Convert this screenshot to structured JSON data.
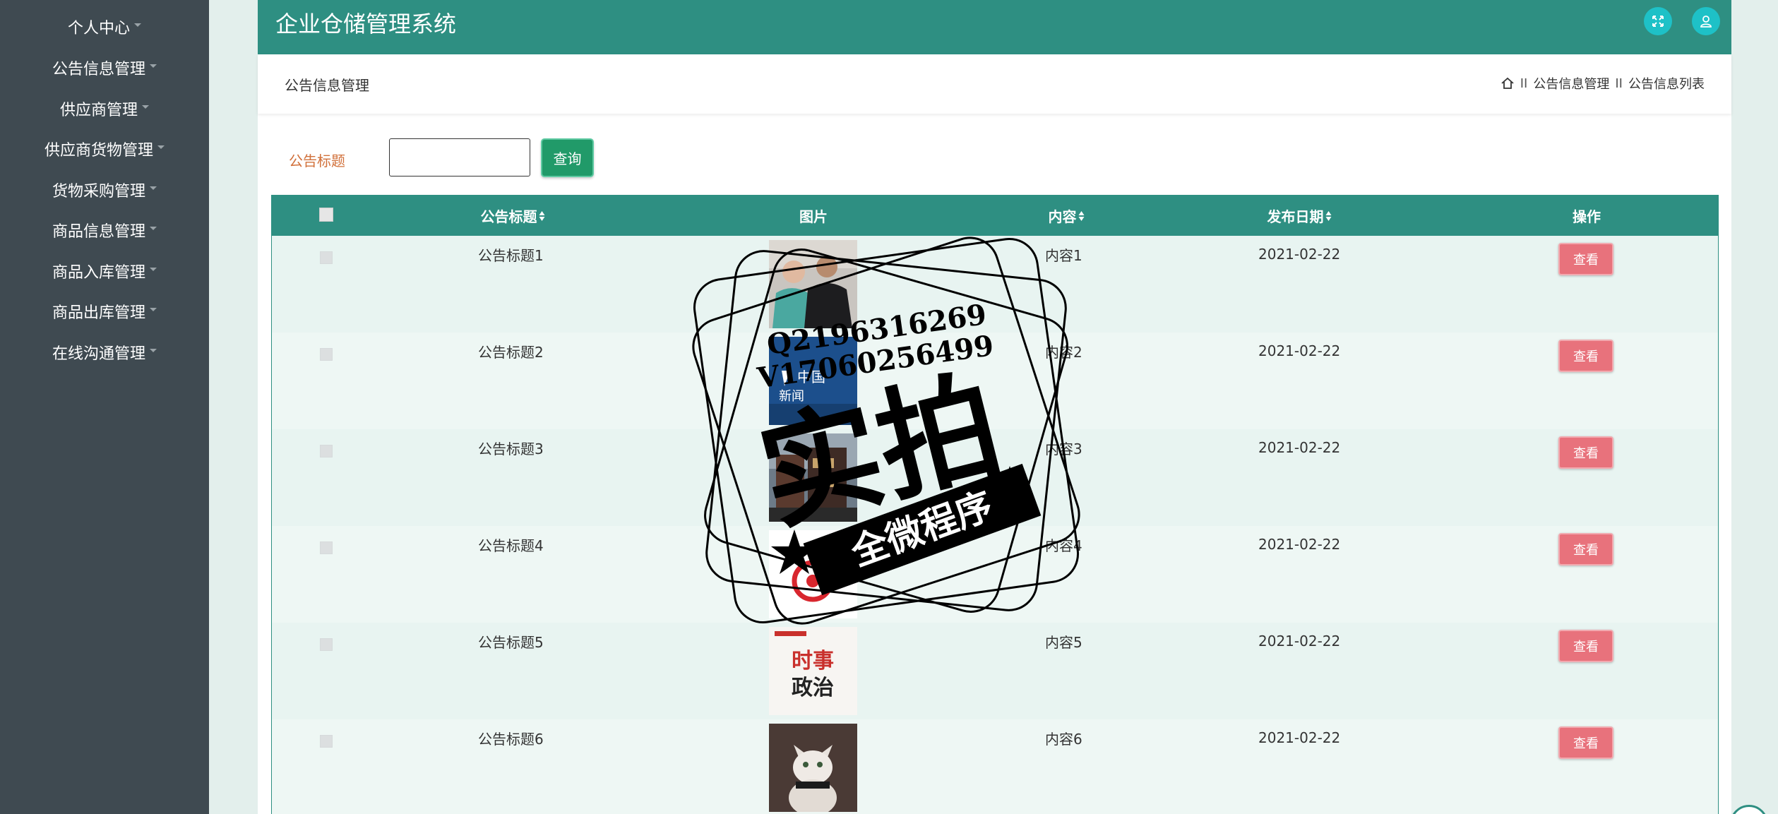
{
  "sidebar": {
    "items": [
      {
        "label": "个人中心"
      },
      {
        "label": "公告信息管理"
      },
      {
        "label": "供应商管理"
      },
      {
        "label": "供应商货物管理"
      },
      {
        "label": "货物采购管理"
      },
      {
        "label": "商品信息管理"
      },
      {
        "label": "商品入库管理"
      },
      {
        "label": "商品出库管理"
      },
      {
        "label": "在线沟通管理"
      }
    ]
  },
  "header": {
    "title": "企业仓储管理系统",
    "icons": [
      "fullscreen-icon",
      "user-icon"
    ]
  },
  "breadcrumb": {
    "page_title": "公告信息管理",
    "home_icon": "home-icon",
    "separator": "II",
    "items": [
      "公告信息管理",
      "公告信息列表"
    ]
  },
  "search": {
    "label": "公告标题",
    "value": "",
    "button_label": "查询"
  },
  "table": {
    "columns": [
      "公告标题",
      "图片",
      "内容",
      "发布日期",
      "操作"
    ],
    "sortable": [
      true,
      false,
      true,
      true,
      false
    ],
    "rows": [
      {
        "title": "公告标题1",
        "content": "内容1",
        "date": "2021-02-22",
        "action": "查看",
        "image": "people-photo"
      },
      {
        "title": "公告标题2",
        "content": "内容2",
        "date": "2021-02-22",
        "action": "查看",
        "image": "news-logo"
      },
      {
        "title": "公告标题3",
        "content": "内容3",
        "date": "2021-02-22",
        "action": "查看",
        "image": "building-photo"
      },
      {
        "title": "公告标题4",
        "content": "内容4",
        "date": "2021-02-22",
        "action": "查看",
        "image": "red-logo"
      },
      {
        "title": "公告标题5",
        "content": "内容5",
        "date": "2021-02-22",
        "action": "查看",
        "image": "politics-poster"
      },
      {
        "title": "公告标题6",
        "content": "内容6",
        "date": "2021-02-22",
        "action": "查看",
        "image": "cat-photo"
      }
    ]
  },
  "watermark": {
    "line1": "Q2196316269",
    "line2": "V17060256499",
    "main_text": "实拍",
    "banner_text": "全微程序"
  },
  "thumb_text": {
    "news_cn": "中国",
    "news_cn2": "新闻",
    "politics_top": "时事",
    "politics_bottom": "政治"
  },
  "colors": {
    "sidebar_bg": "#3f4a51",
    "header_bg": "#2e8f82",
    "search_btn": "#219a69",
    "view_btn": "#e8727c",
    "label_orange": "#d1703a",
    "header_icon_bg": "#1ec1c7"
  }
}
